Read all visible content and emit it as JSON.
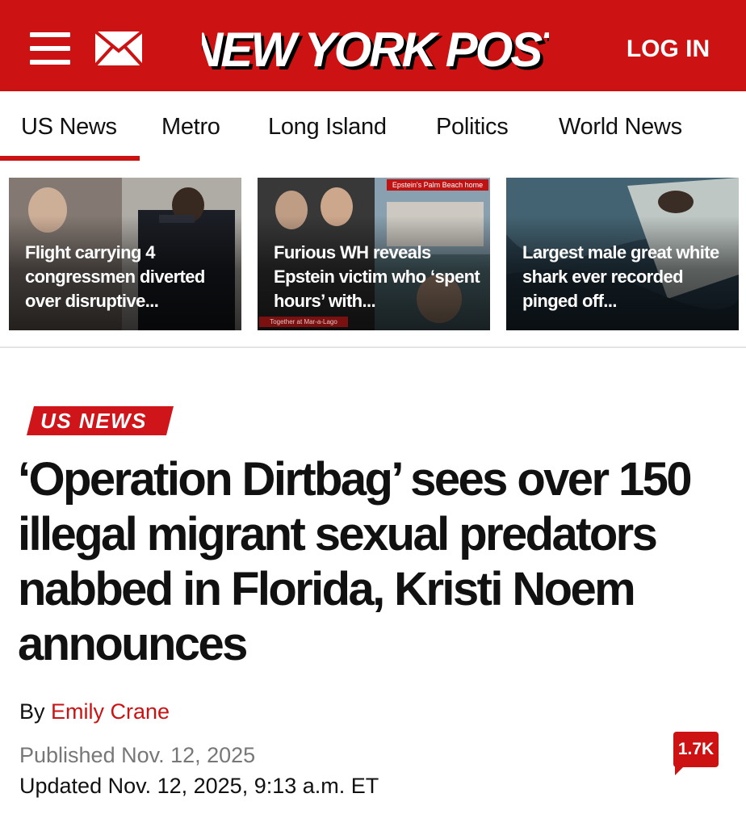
{
  "header": {
    "brand": "NEW YORK POST",
    "login_label": "LOG IN",
    "menu_icon": "hamburger-menu-icon",
    "mail_icon": "envelope-icon",
    "brand_color": "#cc1212"
  },
  "nav": {
    "items": [
      {
        "label": "US News",
        "active": true
      },
      {
        "label": "Metro"
      },
      {
        "label": "Long Island"
      },
      {
        "label": "Politics"
      },
      {
        "label": "World News"
      }
    ]
  },
  "stories": [
    {
      "title": "Flight carrying 4 congressmen diverted over disruptive..."
    },
    {
      "title": "Furious WH reveals Epstein victim who ‘spent hours’ with...",
      "image_caption_top": "Epstein's Palm Beach home",
      "image_caption_bottom": "Together at Mar-a-Lago"
    },
    {
      "title": "Largest male great white shark ever recorded pinged off..."
    }
  ],
  "article": {
    "kicker": "US NEWS",
    "headline": "‘Operation Dirtbag’ sees over 150 illegal migrant sexual predators nabbed in Florida, Kristi Noem announces",
    "byline_prefix": "By",
    "author": "Emily Crane",
    "published": "Published Nov. 12, 2025",
    "updated": "Updated Nov. 12, 2025, 9:13 a.m. ET",
    "comment_count": "1.7K"
  }
}
